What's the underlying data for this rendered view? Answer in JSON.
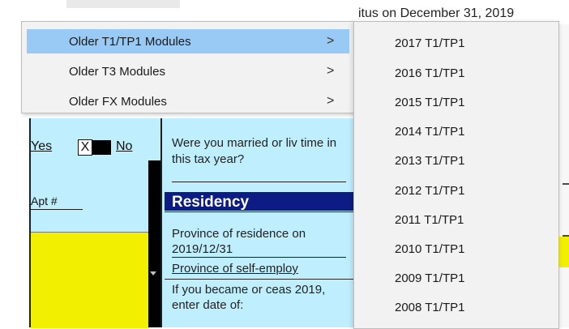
{
  "background": {
    "top_status_text": "itus on December 31, 2019",
    "left": {
      "yes": "Yes",
      "x_mark": "X",
      "no": "No",
      "apt": "Apt #"
    },
    "mid": {
      "question": "Were you married or liv time in this tax year?",
      "residency_title": "Residency",
      "province_of_residence": "Province of residence on 2019/12/31",
      "province_self_employment": "Province of self-employ",
      "became_ceased": "If you became or ceas 2019, enter date of:"
    }
  },
  "menu": {
    "items": [
      {
        "label": "Older T1/TP1 Modules",
        "chevron": ">",
        "active": true
      },
      {
        "label": "Older T3 Modules",
        "chevron": ">",
        "active": false
      },
      {
        "label": "Older FX Modules",
        "chevron": ">",
        "active": false
      }
    ]
  },
  "submenu": {
    "items": [
      "2017 T1/TP1",
      "2016 T1/TP1",
      "2015 T1/TP1",
      "2014 T1/TP1",
      "2013 T1/TP1",
      "2012 T1/TP1",
      "2011 T1/TP1",
      "2010 T1/TP1",
      "2009 T1/TP1",
      "2008 T1/TP1"
    ]
  },
  "colors": {
    "menu_background": "#f2f2f2",
    "menu_highlight": "#99c9f5",
    "form_cyan": "#bfefff",
    "form_yellow": "#f3ef00",
    "residency_bar": "#0c1c84"
  }
}
